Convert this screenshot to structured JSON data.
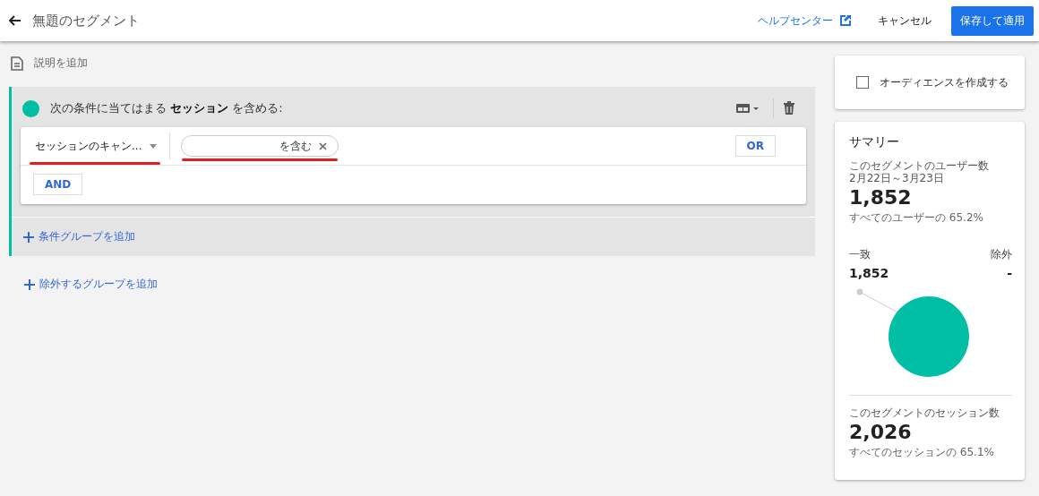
{
  "header": {
    "title": "無題のセグメント",
    "help_link": "ヘルプセンター",
    "cancel": "キャンセル",
    "save": "保存して適用"
  },
  "description_link": "説明を追加",
  "group": {
    "color": "#00bfa5",
    "heading": "次の条件に当てはまる **セッション** を含める:",
    "condition": {
      "dimension": "セッションのキャン...",
      "operator": "を含む",
      "or_button": "OR"
    },
    "and_button": "AND",
    "add_group": "条件グループを追加"
  },
  "add_exclude": "除外するグループを追加",
  "audience": {
    "label": "オーディエンスを作成する",
    "checked": false
  },
  "summary": {
    "title": "サマリー",
    "users_label": "このセグメントのユーザー数",
    "date_range": "2月22日～3月23日",
    "users_value": "1,852",
    "users_share": "すべてのユーザーの 65.2%",
    "match_label": "一致",
    "exclude_label": "除外",
    "match_value": "1,852",
    "exclude_value": "-",
    "sessions_label": "このセグメントのセッション数",
    "sessions_value": "2,026",
    "sessions_share": "すべてのセッションの 65.1%"
  }
}
